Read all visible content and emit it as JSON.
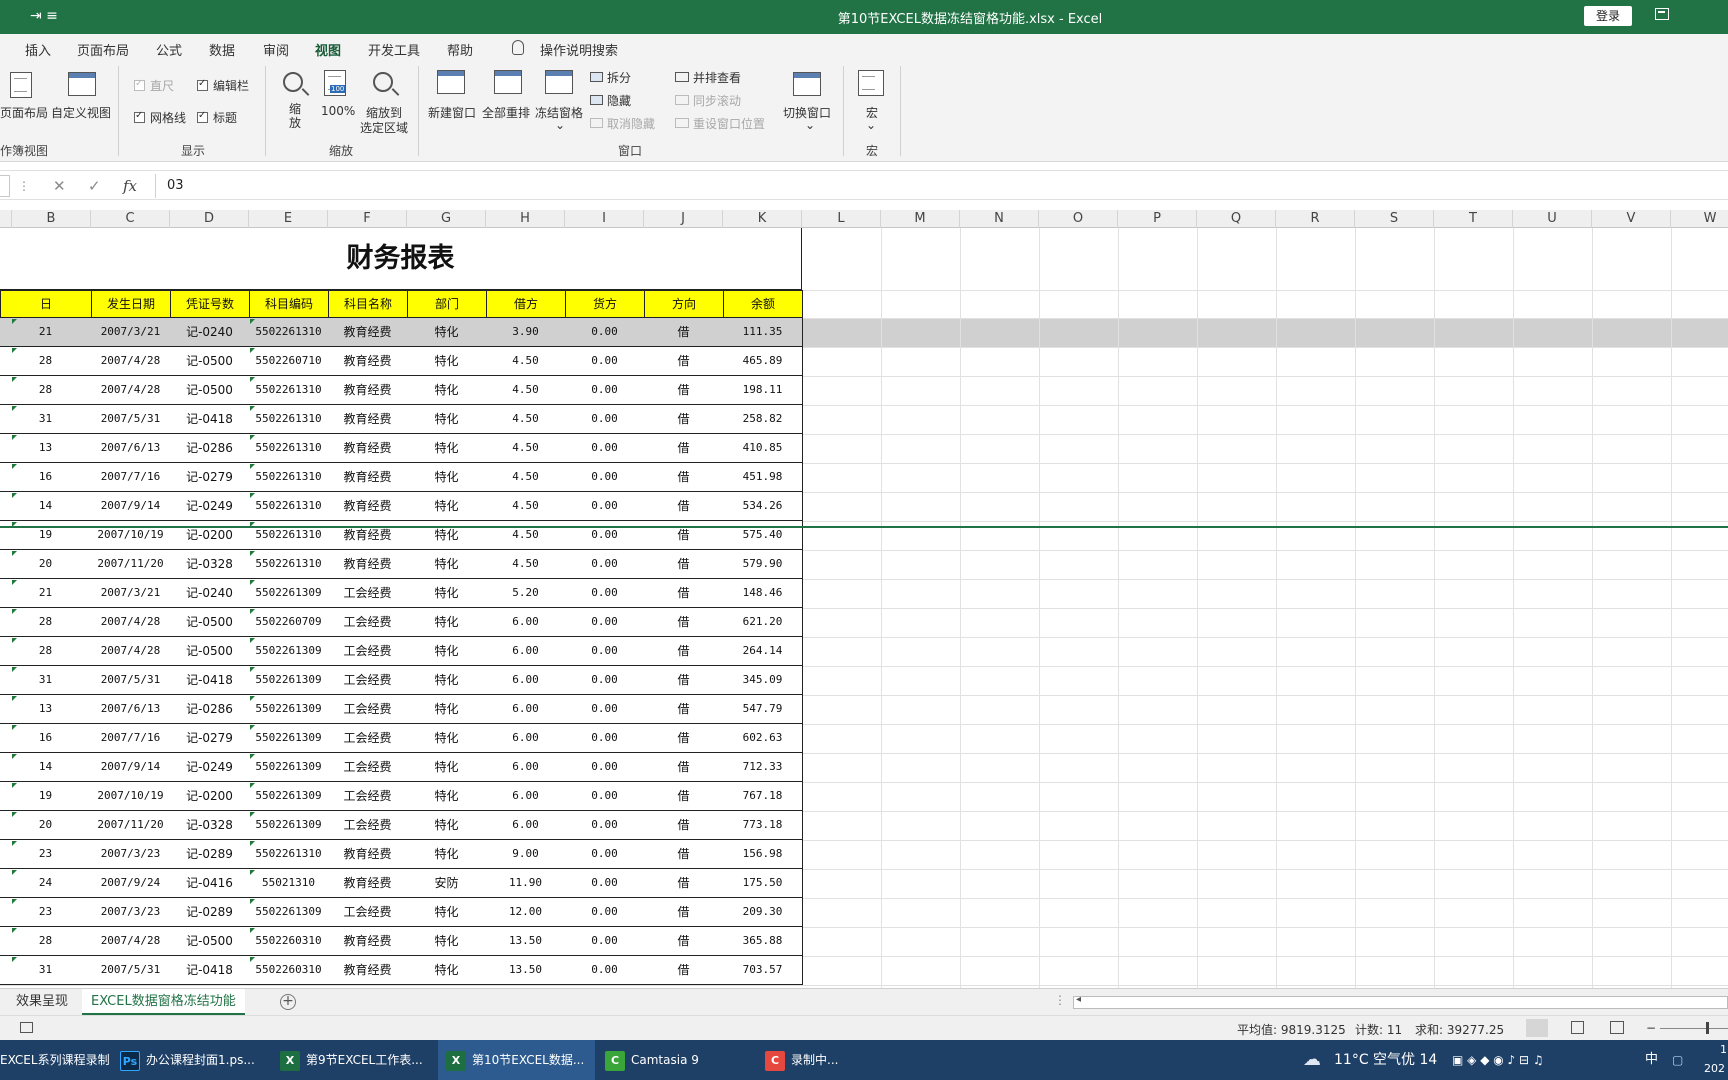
{
  "window": {
    "title": "第10节EXCEL数据冻结窗格功能.xlsx  -  Excel",
    "quick_access": "⇥  ≡",
    "login_label": "登录"
  },
  "tabs": [
    "插入",
    "页面布局",
    "公式",
    "数据",
    "审阅",
    "视图",
    "开发工具",
    "帮助"
  ],
  "active_tab": "视图",
  "search_label": "操作说明搜索",
  "ribbon": {
    "workbook_views": {
      "page_layout": "页面布局",
      "custom_view": "自定义视图",
      "group": "作簿视图"
    },
    "show": {
      "ruler": "直尺",
      "formula_bar": "编辑栏",
      "gridlines": "网格线",
      "headings": "标题",
      "group": "显示"
    },
    "zoom": {
      "zoom": "缩放",
      "hundred": "100%",
      "hundred_badge": "100",
      "zoom_selection_line1": "缩放到",
      "zoom_selection_line2": "选定区域",
      "group": "缩放"
    },
    "window": {
      "new_window": "新建窗口",
      "arrange_all": "全部重排",
      "freeze_panes": "冻结窗格",
      "split": "拆分",
      "hide": "隐藏",
      "unhide": "取消隐藏",
      "side_by_side": "并排查看",
      "sync_scroll": "同步滚动",
      "reset_position": "重设窗口位置",
      "switch_window": "切换窗口",
      "group": "窗口"
    },
    "macros": {
      "macros": "宏",
      "group": "宏"
    }
  },
  "formula_bar": {
    "cancel": "✕",
    "enter": "✓",
    "fx": "fx",
    "value": "03"
  },
  "columns": [
    "B",
    "C",
    "D",
    "E",
    "F",
    "G",
    "H",
    "I",
    "J",
    "K",
    "L",
    "M",
    "N",
    "O",
    "P",
    "Q",
    "R",
    "S",
    "T",
    "U",
    "V",
    "W"
  ],
  "report_title": "财务报表",
  "table_headers": [
    "日",
    "发生日期",
    "凭证号数",
    "科目编码",
    "科目名称",
    "部门",
    "借方",
    "货方",
    "方向",
    "余额"
  ],
  "rows": [
    [
      "21",
      "2007/3/21",
      "记-0240",
      "5502261310",
      "教育经费",
      "特化",
      "3.90",
      "0.00",
      "借",
      "111.35"
    ],
    [
      "28",
      "2007/4/28",
      "记-0500",
      "5502260710",
      "教育经费",
      "特化",
      "4.50",
      "0.00",
      "借",
      "465.89"
    ],
    [
      "28",
      "2007/4/28",
      "记-0500",
      "5502261310",
      "教育经费",
      "特化",
      "4.50",
      "0.00",
      "借",
      "198.11"
    ],
    [
      "31",
      "2007/5/31",
      "记-0418",
      "5502261310",
      "教育经费",
      "特化",
      "4.50",
      "0.00",
      "借",
      "258.82"
    ],
    [
      "13",
      "2007/6/13",
      "记-0286",
      "5502261310",
      "教育经费",
      "特化",
      "4.50",
      "0.00",
      "借",
      "410.85"
    ],
    [
      "16",
      "2007/7/16",
      "记-0279",
      "5502261310",
      "教育经费",
      "特化",
      "4.50",
      "0.00",
      "借",
      "451.98"
    ],
    [
      "14",
      "2007/9/14",
      "记-0249",
      "5502261310",
      "教育经费",
      "特化",
      "4.50",
      "0.00",
      "借",
      "534.26"
    ],
    [
      "19",
      "2007/10/19",
      "记-0200",
      "5502261310",
      "教育经费",
      "特化",
      "4.50",
      "0.00",
      "借",
      "575.40"
    ],
    [
      "20",
      "2007/11/20",
      "记-0328",
      "5502261310",
      "教育经费",
      "特化",
      "4.50",
      "0.00",
      "借",
      "579.90"
    ],
    [
      "21",
      "2007/3/21",
      "记-0240",
      "5502261309",
      "工会经费",
      "特化",
      "5.20",
      "0.00",
      "借",
      "148.46"
    ],
    [
      "28",
      "2007/4/28",
      "记-0500",
      "5502260709",
      "工会经费",
      "特化",
      "6.00",
      "0.00",
      "借",
      "621.20"
    ],
    [
      "28",
      "2007/4/28",
      "记-0500",
      "5502261309",
      "工会经费",
      "特化",
      "6.00",
      "0.00",
      "借",
      "264.14"
    ],
    [
      "31",
      "2007/5/31",
      "记-0418",
      "5502261309",
      "工会经费",
      "特化",
      "6.00",
      "0.00",
      "借",
      "345.09"
    ],
    [
      "13",
      "2007/6/13",
      "记-0286",
      "5502261309",
      "工会经费",
      "特化",
      "6.00",
      "0.00",
      "借",
      "547.79"
    ],
    [
      "16",
      "2007/7/16",
      "记-0279",
      "5502261309",
      "工会经费",
      "特化",
      "6.00",
      "0.00",
      "借",
      "602.63"
    ],
    [
      "14",
      "2007/9/14",
      "记-0249",
      "5502261309",
      "工会经费",
      "特化",
      "6.00",
      "0.00",
      "借",
      "712.33"
    ],
    [
      "19",
      "2007/10/19",
      "记-0200",
      "5502261309",
      "工会经费",
      "特化",
      "6.00",
      "0.00",
      "借",
      "767.18"
    ],
    [
      "20",
      "2007/11/20",
      "记-0328",
      "5502261309",
      "工会经费",
      "特化",
      "6.00",
      "0.00",
      "借",
      "773.18"
    ],
    [
      "23",
      "2007/3/23",
      "记-0289",
      "5502261310",
      "教育经费",
      "特化",
      "9.00",
      "0.00",
      "借",
      "156.98"
    ],
    [
      "24",
      "2007/9/24",
      "记-0416",
      "55021310",
      "教育经费",
      "安防",
      "11.90",
      "0.00",
      "借",
      "175.50"
    ],
    [
      "23",
      "2007/3/23",
      "记-0289",
      "5502261309",
      "工会经费",
      "特化",
      "12.00",
      "0.00",
      "借",
      "209.30"
    ],
    [
      "28",
      "2007/4/28",
      "记-0500",
      "5502260310",
      "教育经费",
      "特化",
      "13.50",
      "0.00",
      "借",
      "365.88"
    ],
    [
      "31",
      "2007/5/31",
      "记-0418",
      "5502260310",
      "教育经费",
      "特化",
      "13.50",
      "0.00",
      "借",
      "703.57"
    ]
  ],
  "selected_row": 0,
  "sheet_tabs": [
    "效果呈现",
    "EXCEL数据窗格冻结功能"
  ],
  "active_sheet": 1,
  "status": {
    "average": "平均值: 9819.3125",
    "count": "计数: 11",
    "sum": "求和: 39277.25"
  },
  "taskbar": {
    "items": [
      {
        "label": "EXCEL系列课程录制",
        "icon": ""
      },
      {
        "label": "办公课程封面1.ps...",
        "icon": "Ps"
      },
      {
        "label": "第9节EXCEL工作表...",
        "icon": "X"
      },
      {
        "label": "第10节EXCEL数据...",
        "icon": "X"
      },
      {
        "label": "Camtasia 9",
        "icon": "C"
      },
      {
        "label": "录制中...",
        "icon": "C"
      }
    ],
    "weather": "11°C  空气优 14",
    "ime": "中",
    "clock_top": "1",
    "clock_bottom": "202"
  }
}
